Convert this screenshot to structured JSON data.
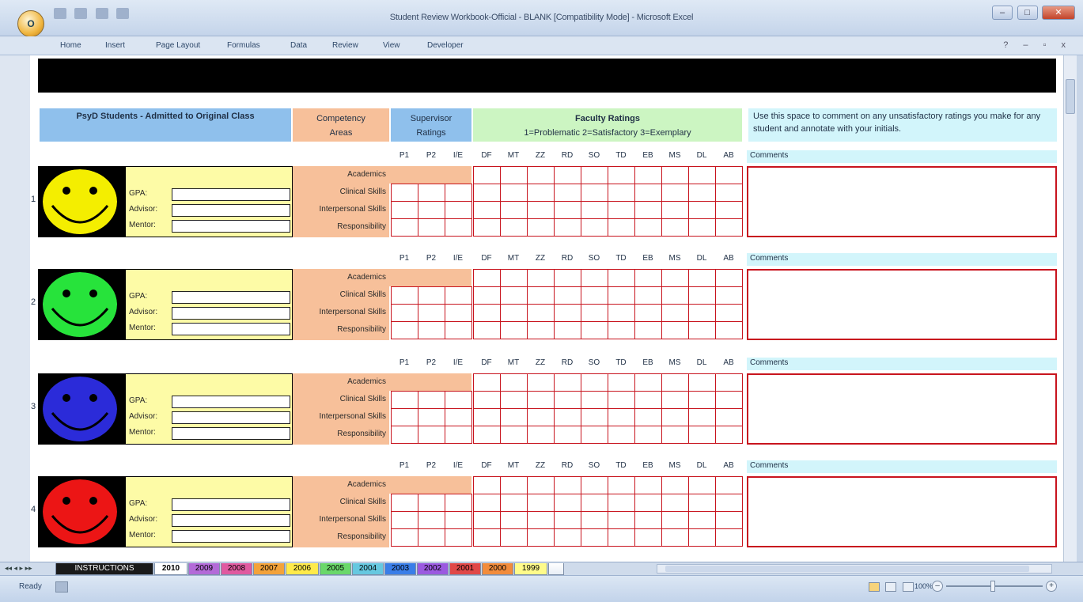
{
  "window": {
    "title": "Student Review Workbook-Official - BLANK [Compatibility Mode] - Microsoft Excel",
    "controls": {
      "minimize": "–",
      "maximize": "□",
      "close": "✕"
    }
  },
  "office_button": {
    "label": "O"
  },
  "ribbon": {
    "tabs": [
      "Home",
      "Insert",
      "Page Layout",
      "Formulas",
      "Data",
      "Review",
      "View",
      "Developer"
    ],
    "right_controls": "? – ▫ x"
  },
  "header": {
    "students_title": "PsyD Students - Admitted to Original Class",
    "competency_line1": "Competency",
    "competency_line2": "Areas",
    "supervisor_line1": "Supervisor",
    "supervisor_line2": "Ratings",
    "faculty_title": "Faculty Ratings",
    "faculty_scale": "1=Problematic   2=Satisfactory   3=Exemplary",
    "comment_instructions": "Use this space to comment on any unsatisfactory ratings you make for any student and annotate with your initials."
  },
  "rating_columns": [
    "P1",
    "P2",
    "I/E",
    "DF",
    "MT",
    "ZZ",
    "RD",
    "SO",
    "TD",
    "EB",
    "MS",
    "DL",
    "AB"
  ],
  "comments_label": "Comments",
  "info_labels": {
    "gpa": "GPA:",
    "advisor": "Advisor:",
    "mentor": "Mentor:"
  },
  "competency_areas": [
    "Academics",
    "Clinical Skills",
    "Interpersonal Skills",
    "Responsibility"
  ],
  "students": [
    {
      "number": "1",
      "face_color": "#f4ee00"
    },
    {
      "number": "2",
      "face_color": "#27e33b"
    },
    {
      "number": "3",
      "face_color": "#2b2bd9"
    },
    {
      "number": "4",
      "face_color": "#ec1515"
    }
  ],
  "sheet_tabs": {
    "nav": "◂◂ ◂ ▸ ▸▸",
    "items": [
      "INSTRUCTIONS",
      "2010",
      "2009",
      "2008",
      "2007",
      "2006",
      "2005",
      "2004",
      "2003",
      "2002",
      "2001",
      "2000",
      "1999"
    ],
    "active": "2010",
    "colors": [
      "#1a1a1a",
      "#ffffff",
      "#b36ad8",
      "#e05aa0",
      "#f3a23a",
      "#ffea4a",
      "#6ad86a",
      "#66c8e0",
      "#3a7ee8",
      "#9b5ae0",
      "#e04848",
      "#f28c3c",
      "#fffb8a"
    ]
  },
  "status": {
    "ready": "Ready",
    "zoom": "100%",
    "zoom_minus": "–",
    "zoom_plus": "+"
  }
}
